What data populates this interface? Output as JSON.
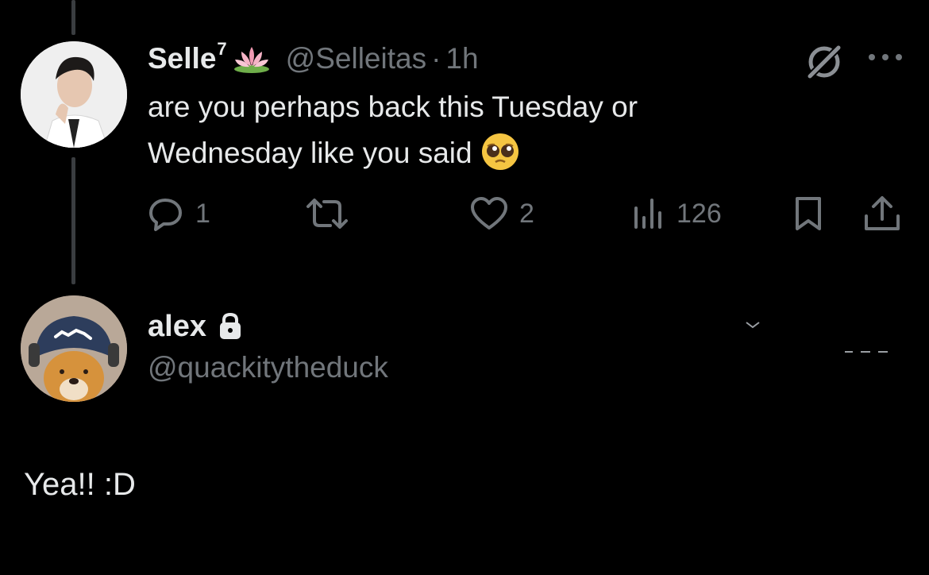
{
  "reply_tweet": {
    "display_name": "Selle",
    "name_superscript": "7",
    "name_emoji": "lotus-icon",
    "handle": "@Selleitas",
    "separator": "·",
    "time": "1h",
    "text_line1": "are you perhaps back this Tuesday or",
    "text_line2": "Wednesday like you said",
    "text_emoji": "pleading-face-emoji",
    "actions": {
      "reply_count": "1",
      "retweet_count": "",
      "like_count": "2",
      "view_count": "126"
    }
  },
  "author": {
    "display_name": "alex",
    "handle": "@quackitytheduck",
    "protected": true
  },
  "main_tweet": {
    "text": "Yea!! :D"
  },
  "colors": {
    "background": "#000000",
    "primary_text": "#e7e9ea",
    "secondary_text": "#71767b",
    "thread_line": "#3a3d40"
  }
}
